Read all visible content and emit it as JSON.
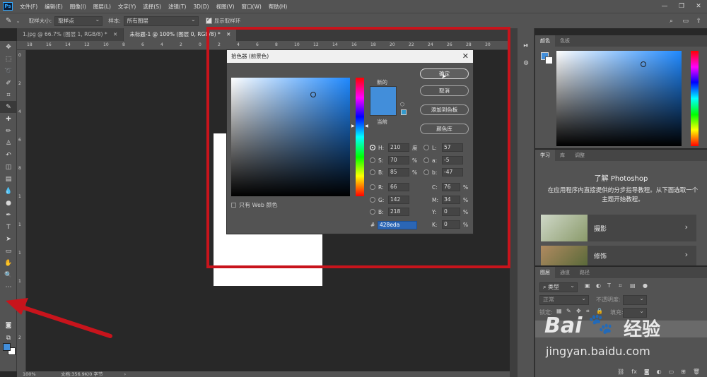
{
  "menubar": {
    "logo": "Ps",
    "items": [
      "文件(F)",
      "编辑(E)",
      "图像(I)",
      "图层(L)",
      "文字(Y)",
      "选择(S)",
      "滤镜(T)",
      "3D(D)",
      "视图(V)",
      "窗口(W)",
      "帮助(H)"
    ]
  },
  "options": {
    "sample_size_label": "取样大小:",
    "sample_size_value": "取样点",
    "sample_label": "样本:",
    "sample_value": "所有图层",
    "show_ring_label": "显示取样环"
  },
  "tabs": [
    "1.jpg @ 66.7% (图层 1, RGB/8) *",
    "未标题-1 @ 100% (图层 0, RGB/8) *"
  ],
  "ruler": {
    "h_ticks": [
      "18",
      "16",
      "14",
      "12",
      "10",
      "8",
      "6",
      "4",
      "2",
      "0",
      "2",
      "4",
      "6",
      "8",
      "10",
      "12",
      "14",
      "16",
      "18",
      "20",
      "22",
      "24",
      "26",
      "28",
      "30"
    ],
    "v_ticks": [
      "0",
      "2",
      "4",
      "6",
      "8",
      "1",
      "1",
      "1",
      "1",
      "2",
      "2"
    ]
  },
  "status": {
    "zoom": "100%",
    "doc_info": "文档:356.9K/0 字节"
  },
  "color_panel": {
    "tabs": [
      "颜色",
      "色板"
    ]
  },
  "learn_panel": {
    "tabs": [
      "学习",
      "库",
      "调整"
    ],
    "title": "了解 Photoshop",
    "description": "在应用程序内直接提供的分步指导教程。从下面选取一个主题开始教程。",
    "items": [
      "摄影",
      "修饰"
    ]
  },
  "layers_panel": {
    "tabs": [
      "图层",
      "通道",
      "路径"
    ],
    "filter_label": "类型",
    "blend_mode": "正常",
    "opacity_label": "不透明度:",
    "lock_label": "锁定:",
    "fill_label": "填充:"
  },
  "picker": {
    "title": "拾色器 (前景色)",
    "new_label": "新的",
    "current_label": "当前",
    "ok": "确定",
    "cancel": "取消",
    "add_swatch": "添加到色板",
    "color_lib": "颜色库",
    "web_only": "只有 Web 颜色",
    "H": "210",
    "H_unit": "度",
    "S": "70",
    "S_unit": "%",
    "B": "85",
    "B_unit": "%",
    "R": "66",
    "G": "142",
    "Bv": "218",
    "L": "57",
    "a": "-5",
    "b": "-47",
    "C": "76",
    "M": "34",
    "Y": "0",
    "K": "0",
    "hex": "428eda",
    "hex_label": "#",
    "selected_color": "#428eda"
  },
  "watermark": {
    "brand": "Bai",
    "brand2": "经验",
    "url": "jingyan.baidu.com"
  }
}
